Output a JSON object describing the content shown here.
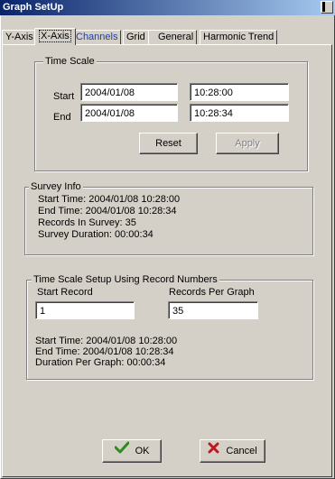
{
  "window": {
    "title": "Graph SetUp"
  },
  "tabs": [
    {
      "label": "Y-Axis",
      "active": false
    },
    {
      "label": "X-Axis",
      "active": true
    },
    {
      "label": "Channels",
      "active": false
    },
    {
      "label": "Grid",
      "active": false
    },
    {
      "label": "General",
      "active": false
    },
    {
      "label": "Harmonic Trend",
      "active": false
    }
  ],
  "time_scale": {
    "legend": "Time Scale",
    "start_label": "Start",
    "end_label": "End",
    "start_date": "2004/01/08",
    "start_time": "10:28:00",
    "end_date": "2004/01/08",
    "end_time": "10:28:34",
    "reset_label": "Reset",
    "apply_label": "Apply"
  },
  "survey_info": {
    "legend": "Survey Info",
    "start_time": "Start Time: 2004/01/08 10:28:00",
    "end_time": "End Time: 2004/01/08 10:28:34",
    "records": "Records In Survey: 35",
    "duration": "Survey Duration: 00:00:34"
  },
  "record_setup": {
    "legend": "Time Scale Setup Using Record Numbers",
    "start_record_label": "Start Record",
    "records_per_graph_label": "Records Per Graph",
    "start_record_value": "1",
    "records_per_graph_value": "35",
    "start_time": "Start Time: 2004/01/08 10:28:00",
    "end_time": "End Time: 2004/01/08 10:28:34",
    "duration": "Duration Per Graph: 00:00:34"
  },
  "footer": {
    "ok_label": "OK",
    "cancel_label": "Cancel"
  },
  "colors": {
    "titlebar_start": "#0a246a",
    "titlebar_end": "#a6caf0",
    "face": "#d4d0c8",
    "tab_link": "#1d3faa",
    "ok_check": "#2e8b1e",
    "cancel_x": "#c0181a"
  }
}
